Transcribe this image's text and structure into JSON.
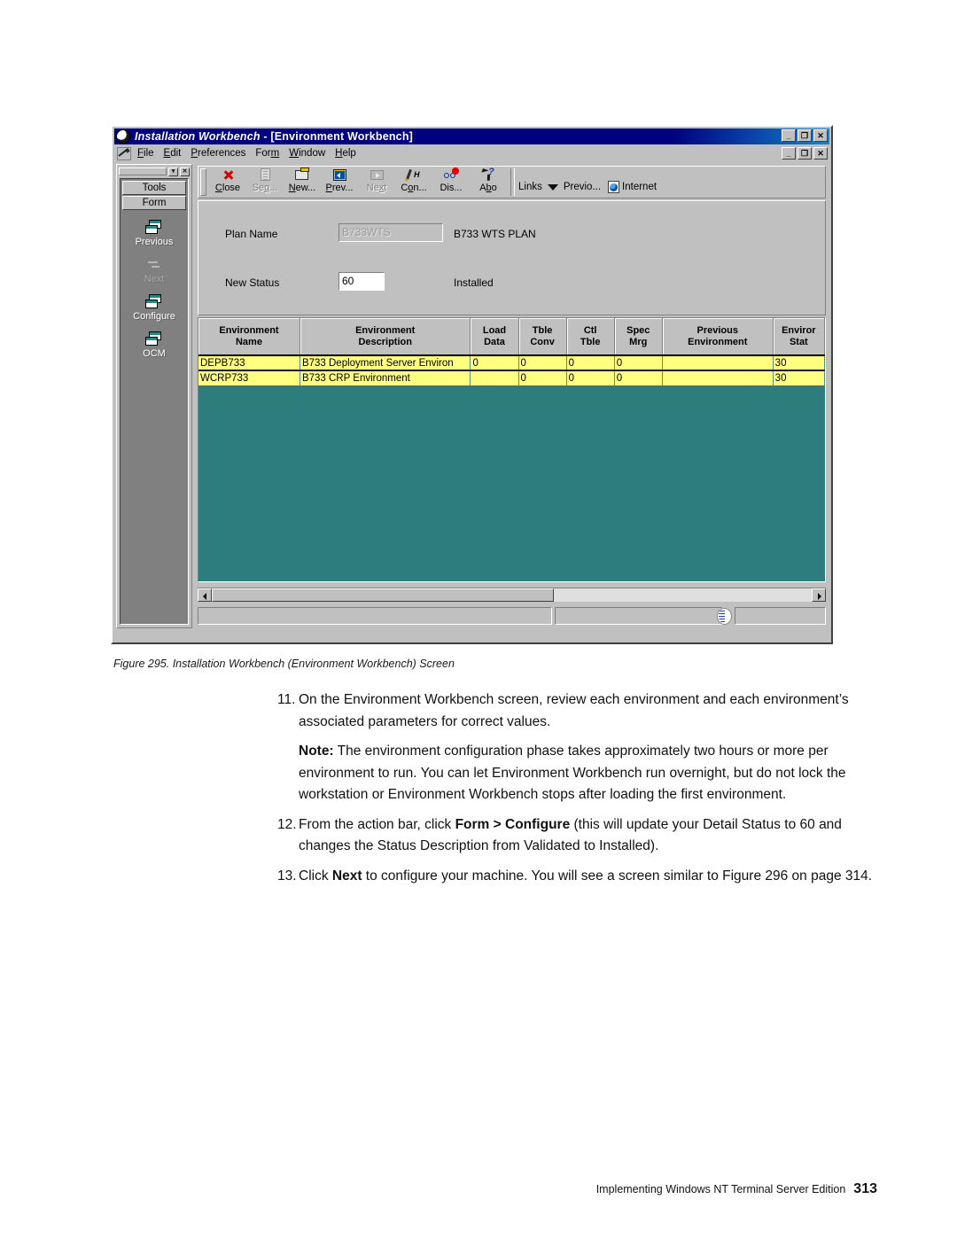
{
  "window": {
    "title_app": "Installation Workbench",
    "title_sep": " - [Environment Workbench]",
    "app_icon": "globe-icon",
    "buttons": {
      "minimize": "_",
      "restore": "❐",
      "close": "✕"
    }
  },
  "menubar": {
    "icon": "pencil-document-icon",
    "items": [
      {
        "label": "File",
        "accel": "F"
      },
      {
        "label": "Edit",
        "accel": "E"
      },
      {
        "label": "Preferences",
        "accel": "P"
      },
      {
        "label": "Form",
        "accel": "m"
      },
      {
        "label": "Window",
        "accel": "W"
      },
      {
        "label": "Help",
        "accel": "H"
      }
    ]
  },
  "toolpane": {
    "close_label": "✕",
    "dropdown_label": "▾",
    "tabs": [
      {
        "label": "Tools"
      },
      {
        "label": "Form"
      }
    ],
    "items": [
      {
        "label": "Previous",
        "icon": "pages-icon",
        "enabled": true
      },
      {
        "label": "Next",
        "icon": "arrow-icon",
        "enabled": false
      },
      {
        "label": "Configure",
        "icon": "pages-icon",
        "enabled": true
      },
      {
        "label": "OCM",
        "icon": "pages-icon",
        "enabled": true
      }
    ]
  },
  "toolbar": {
    "buttons": [
      {
        "label": "Close",
        "accel": "C",
        "icon": "red-x-icon",
        "enabled": true
      },
      {
        "label": "Seq...",
        "accel": "q",
        "icon": "document-list-icon",
        "enabled": false
      },
      {
        "label": "New...",
        "accel": "N",
        "icon": "folder-open-icon",
        "enabled": true
      },
      {
        "label": "Prev...",
        "accel": "P",
        "icon": "arrow-left-icon",
        "enabled": true
      },
      {
        "label": "Next",
        "accel": "x",
        "icon": "arrow-right-icon",
        "enabled": false
      },
      {
        "label": "Con...",
        "accel": "o",
        "icon": "pencil-h-icon",
        "enabled": true
      },
      {
        "label": "Dis...",
        "accel": "",
        "icon": "glasses-icon",
        "enabled": true
      },
      {
        "label": "Abo",
        "accel": "b",
        "icon": "cursor-help-icon",
        "enabled": true
      }
    ],
    "links_label": "Links",
    "links_caret": "caret-down-icon",
    "previous_label": "Previo...",
    "internet_icon": "internet-icon",
    "internet_label": "Internet"
  },
  "form": {
    "plan_name_label": "Plan Name",
    "plan_name_value": "B733WTS",
    "plan_name_desc": "B733 WTS PLAN",
    "new_status_label": "New Status",
    "new_status_value": "60",
    "new_status_desc": "Installed"
  },
  "grid": {
    "columns": [
      "Environment\nName",
      "Environment\nDescription",
      "Load\nData",
      "Tble\nConv",
      "Ctl\nTble",
      "Spec\nMrg",
      "Previous\nEnvironment",
      "Enviror\nStat"
    ],
    "rows": [
      [
        "DEPB733",
        "B733 Deployment Server Environ",
        "0",
        "0",
        "0",
        "0",
        "",
        "30"
      ],
      [
        "WCRP733",
        "B733 CRP Environment",
        "",
        "0",
        "0",
        "0",
        "",
        "30"
      ]
    ],
    "background_color": "#2d7d7d",
    "row_color": "#ffff80"
  },
  "scrollbar": {
    "left_arrow": "arrow-left-icon",
    "right_arrow": "arrow-right-icon"
  },
  "statusbar": {
    "globe_icon": "globe-icon"
  },
  "caption": "Figure 295.  Installation Workbench (Environment Workbench) Screen",
  "steps": [
    {
      "num": "11.",
      "text": "On the Environment Workbench screen, review each environment and each environment’s associated parameters for correct values."
    },
    {
      "num": "12.",
      "text_pre": "From the action bar, click ",
      "text_bold": "Form > Configure",
      "text_post": " (this will update your Detail Status to 60 and changes the Status Description from Validated to Installed)."
    },
    {
      "num": "13.",
      "text_pre": "Click ",
      "text_bold": "Next",
      "text_post": " to configure your machine. You will see a screen similar to Figure 296 on page 314."
    }
  ],
  "note": {
    "label": "Note:",
    "text": " The environment configuration phase takes approximately two hours or more per environment to run. You can let Environment Workbench run overnight, but do not lock the workstation or Environment Workbench stops after loading the first environment."
  },
  "footer": {
    "text": "Implementing Windows NT Terminal Server Edition",
    "page": "313"
  }
}
